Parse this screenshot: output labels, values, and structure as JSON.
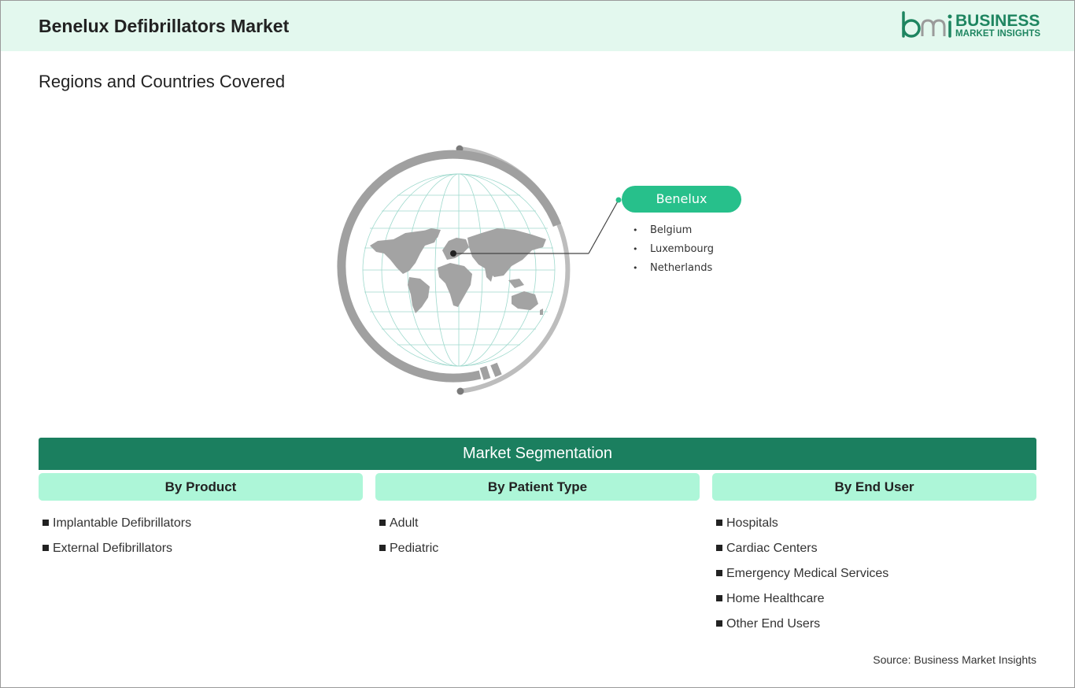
{
  "header": {
    "title": "Benelux Defibrillators Market",
    "logo_line1": "BUSINESS",
    "logo_line2": "MARKET INSIGHTS",
    "logo_mark": "bmi",
    "background_color": "#e3f8ee",
    "brand_color": "#1e8560"
  },
  "subtitle": "Regions and Countries Covered",
  "region": {
    "name": "Benelux",
    "countries": [
      "Belgium",
      "Luxembourg",
      "Netherlands"
    ],
    "pill_color": "#27c08b"
  },
  "segmentation": {
    "title": "Market Segmentation",
    "bar_color": "#1b7f5f",
    "header_color": "#adf6d8",
    "columns": [
      {
        "heading": "By Product",
        "items": [
          "Implantable Defibrillators",
          "External Defibrillators"
        ]
      },
      {
        "heading": "By Patient Type",
        "items": [
          "Adult",
          "Pediatric"
        ]
      },
      {
        "heading": "By End User",
        "items": [
          "Hospitals",
          "Cardiac Centers",
          "Emergency Medical Services",
          "Home Healthcare",
          "Other End Users"
        ]
      }
    ]
  },
  "source": "Source: Business Market Insights"
}
